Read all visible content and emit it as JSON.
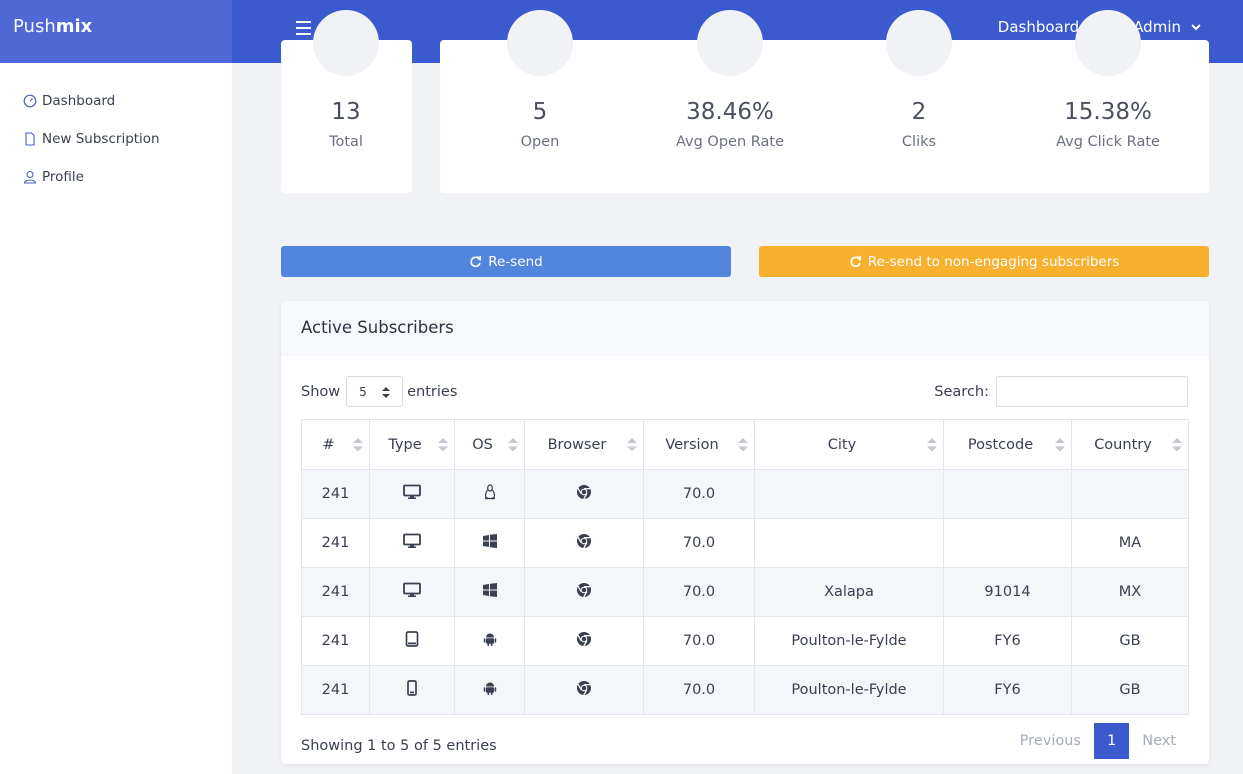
{
  "brand": {
    "part1": "Push",
    "part2": "mix"
  },
  "topnav": {
    "dashboard": "Dashboard",
    "admin": "Admin"
  },
  "sidebar": {
    "items": [
      {
        "label": "Dashboard",
        "icon": "gauge-icon"
      },
      {
        "label": "New Subscription",
        "icon": "file-icon"
      },
      {
        "label": "Profile",
        "icon": "user-icon"
      }
    ]
  },
  "stats": {
    "total": {
      "value": "13",
      "label": "Total"
    },
    "open": {
      "value": "5",
      "label": "Open"
    },
    "avg_open_rate": {
      "value": "38.46%",
      "label": "Avg Open Rate"
    },
    "clicks": {
      "value": "2",
      "label": "Cliks"
    },
    "avg_click_rate": {
      "value": "15.38%",
      "label": "Avg Click Rate"
    }
  },
  "buttons": {
    "resend": "Re-send",
    "resend_non_engaging": "Re-send to non-engaging subscribers"
  },
  "colors": {
    "topbar": "#3a5acd",
    "brand": "#5068d6",
    "resend": "#5185de",
    "resend_non_engaging": "#f7b12e"
  },
  "panel": {
    "title": "Active Subscribers",
    "show_label": "Show",
    "entries_label": "entries",
    "page_size": "5",
    "search_label": "Search:",
    "search_value": "",
    "columns": [
      "#",
      "Type",
      "OS",
      "Browser",
      "Version",
      "City",
      "Postcode",
      "Country"
    ],
    "rows": [
      {
        "id": "241",
        "type": "desktop-icon",
        "os": "linux-icon",
        "browser": "chrome-icon",
        "version": "70.0",
        "city": "",
        "postcode": "",
        "country": ""
      },
      {
        "id": "241",
        "type": "desktop-icon",
        "os": "windows-icon",
        "browser": "chrome-icon",
        "version": "70.0",
        "city": "",
        "postcode": "",
        "country": "MA"
      },
      {
        "id": "241",
        "type": "desktop-icon",
        "os": "windows-icon",
        "browser": "chrome-icon",
        "version": "70.0",
        "city": "Xalapa",
        "postcode": "91014",
        "country": "MX"
      },
      {
        "id": "241",
        "type": "tablet-icon",
        "os": "android-icon",
        "browser": "chrome-icon",
        "version": "70.0",
        "city": "Poulton-le-Fylde",
        "postcode": "FY6",
        "country": "GB"
      },
      {
        "id": "241",
        "type": "mobile-icon",
        "os": "android-icon",
        "browser": "chrome-icon",
        "version": "70.0",
        "city": "Poulton-le-Fylde",
        "postcode": "FY6",
        "country": "GB"
      }
    ],
    "info": "Showing 1 to 5 of 5 entries",
    "pager": {
      "previous": "Previous",
      "current": "1",
      "next": "Next"
    }
  }
}
